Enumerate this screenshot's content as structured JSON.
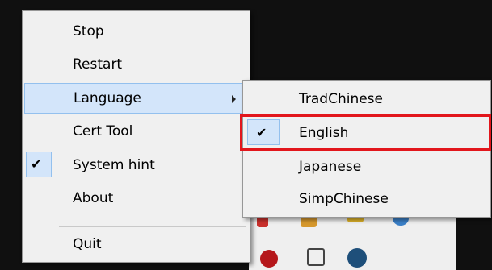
{
  "context_menu": {
    "items": [
      {
        "label": "Stop",
        "checked": false
      },
      {
        "label": "Restart",
        "checked": false
      },
      {
        "label": "Language",
        "checked": false,
        "has_submenu": true
      },
      {
        "label": "Cert Tool",
        "checked": false
      },
      {
        "label": "System hint",
        "checked": true
      },
      {
        "label": "About",
        "checked": false
      },
      {
        "label": "Quit",
        "checked": false
      }
    ],
    "check_glyph": "✔"
  },
  "language_submenu": {
    "items": [
      {
        "label": "TradChinese",
        "checked": false
      },
      {
        "label": "English",
        "checked": true
      },
      {
        "label": "Japanese",
        "checked": false
      },
      {
        "label": "SimpChinese",
        "checked": false
      }
    ]
  },
  "colors": {
    "highlight": "#d3e5fa",
    "annotation_box": "#e2161c"
  }
}
